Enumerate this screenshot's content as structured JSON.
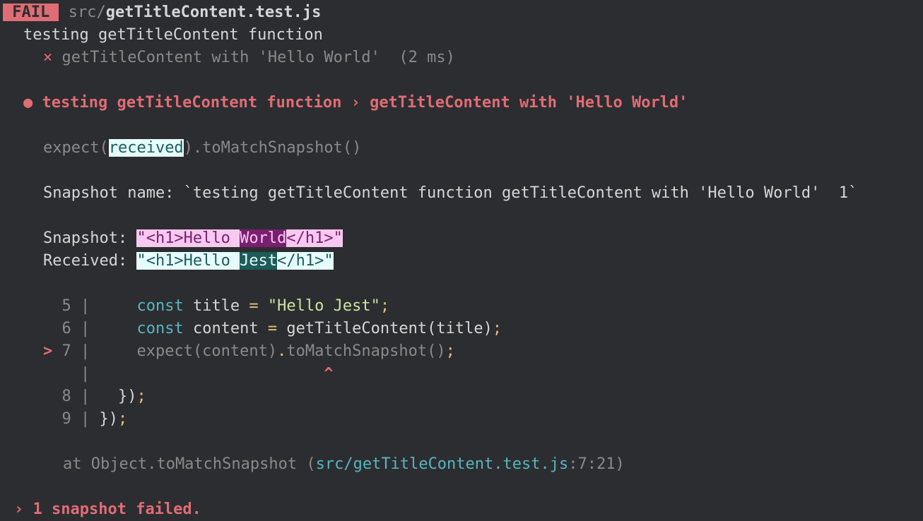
{
  "header": {
    "badge": "FAIL",
    "path_dim": "src/",
    "path_file": "getTitleContent.test.js"
  },
  "suite": {
    "describe": "testing getTitleContent function",
    "test_mark": "×",
    "test_name": "getTitleContent with 'Hello World'",
    "test_time": "(2 ms)"
  },
  "error": {
    "bullet": "●",
    "title": "testing getTitleContent function › getTitleContent with 'Hello World'",
    "expect_prefix": "expect(",
    "expect_received": "received",
    "expect_suffix": ").toMatchSnapshot()",
    "snapshot_name_line": "Snapshot name: `testing getTitleContent function getTitleContent with 'Hello World'  1`",
    "snapshot_label": "Snapshot: ",
    "snapshot_pre": "\"<h1>Hello ",
    "snapshot_diff": "World",
    "snapshot_post": "</h1>\"",
    "received_label": "Received: ",
    "received_pre": "\"<h1>Hello ",
    "received_diff": "Jest",
    "received_post": "</h1>\""
  },
  "code": {
    "l5_num": "  5 | ",
    "l5_kw": "const",
    "l5_var": " title ",
    "l5_eq": "=",
    "l5_str": " \"Hello Jest\"",
    "l5_semi": ";",
    "l6_num": "  6 | ",
    "l6_kw": "const",
    "l6_var": " content ",
    "l6_eq": "=",
    "l6_call": " getTitleContent(title)",
    "l6_semi": ";",
    "l7_marker": ">",
    "l7_num": " 7 | ",
    "l7_a": "expect(content)",
    "l7_dot": ".",
    "l7_b": "toMatchSnapshot()",
    "l7_semi": ";",
    "caret_bar": "|",
    "caret": "^",
    "l8_num": "  8 | ",
    "l8_body": "  })",
    "l8_semi": ";",
    "l9_num": "  9 | ",
    "l9_body": "})",
    "l9_semi": ";"
  },
  "stack": {
    "at": "at Object.toMatchSnapshot (",
    "file": "src/getTitleContent.test.js",
    "loc": ":7:21)"
  },
  "summary": {
    "arrow": "›",
    "text": "1 snapshot failed."
  }
}
